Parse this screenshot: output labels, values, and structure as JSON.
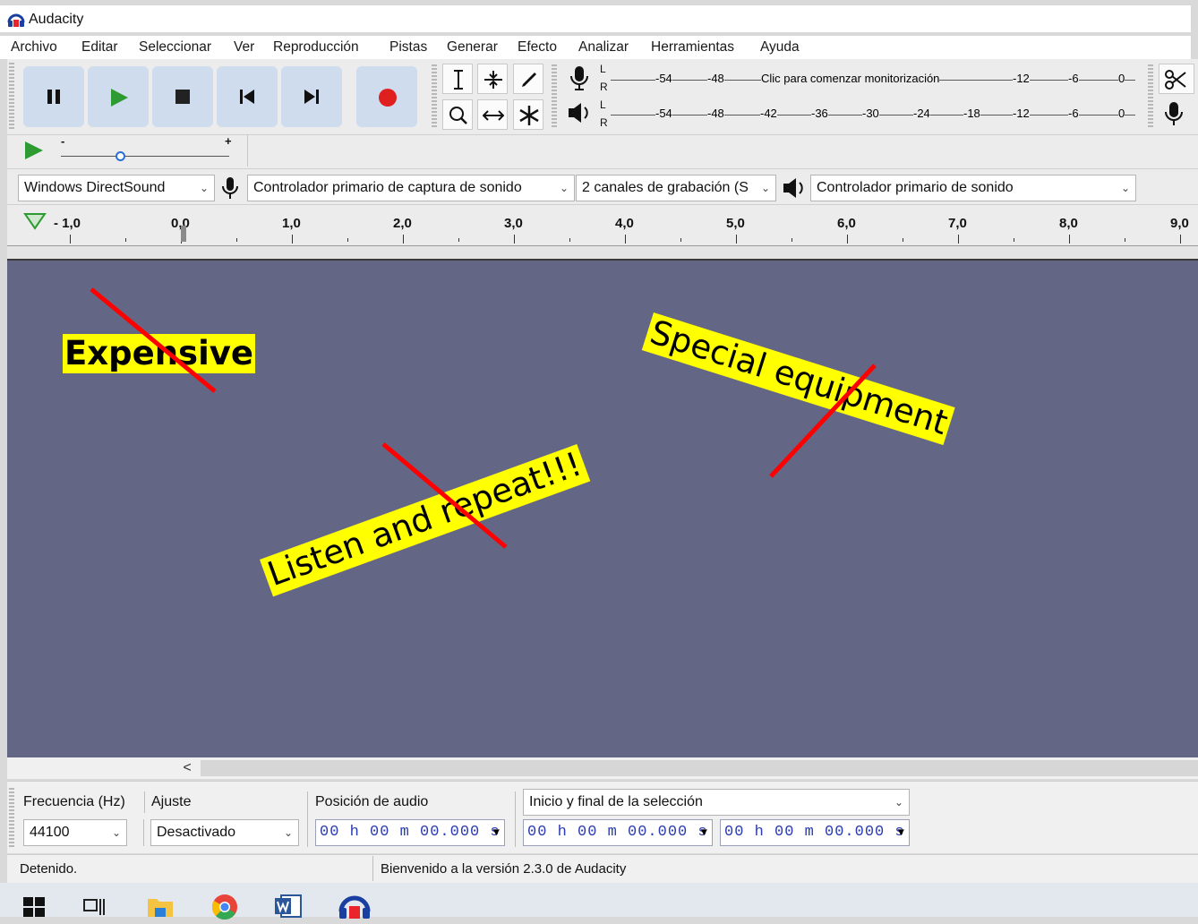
{
  "window": {
    "title": "Audacity",
    "menu": [
      "Archivo",
      "Editar",
      "Seleccionar",
      "Ver",
      "Reproducción",
      "Pistas",
      "Generar",
      "Efecto",
      "Analizar",
      "Herramientas",
      "Ayuda"
    ]
  },
  "transport": {
    "buttons": [
      "pause",
      "play",
      "stop",
      "skip-to-start",
      "skip-to-end",
      "record"
    ]
  },
  "meters": {
    "record_prompt": "Clic para comenzar monitorización",
    "record_scale": [
      "-54",
      "-48",
      "-12",
      "-6",
      "0"
    ],
    "playback_scale": [
      "-54",
      "-48",
      "-42",
      "-36",
      "-30",
      "-24",
      "-18",
      "-12",
      "-6",
      "0"
    ],
    "channel_left": "L",
    "channel_right": "R"
  },
  "play_at_speed": {
    "minus": "-",
    "plus": "+",
    "speed": 0.35
  },
  "devices": {
    "host": "Windows DirectSound",
    "input": "Controlador primario de captura de sonido",
    "channels": "2 canales de grabación (S",
    "output": "Controlador primario de sonido"
  },
  "ruler": {
    "labels": [
      "- 1,0",
      "0,0",
      "1,0",
      "2,0",
      "3,0",
      "4,0",
      "5,0",
      "6,0",
      "7,0",
      "8,0",
      "9,0"
    ]
  },
  "annotations": {
    "sticker_1": "Expensive",
    "sticker_2": "Special equipment",
    "sticker_3": "Listen and repeat!!!",
    "highlight_color": "#ffff00",
    "strike_color": "#ff0000"
  },
  "selection_toolbar": {
    "rate_label": "Frecuencia (Hz)",
    "rate_value": "44100",
    "snap_label": "Ajuste",
    "snap_value": "Desactivado",
    "position_label": "Posición de audio",
    "position_value": "00 h 00 m 00.000 s",
    "selection_mode": "Inicio y final de la selección",
    "selection_start": "00 h 00 m 00.000 s",
    "selection_end": "00 h 00 m 00.000 s"
  },
  "status": {
    "state": "Detenido.",
    "message": "Bienvenido a la versión 2.3.0 de Audacity"
  },
  "scroll": {
    "left_arrow": "<"
  },
  "taskbar": {
    "icons": [
      "windows-start-icon",
      "task-view-icon",
      "file-explorer-icon",
      "chrome-icon",
      "word-icon",
      "audacity-icon"
    ]
  }
}
